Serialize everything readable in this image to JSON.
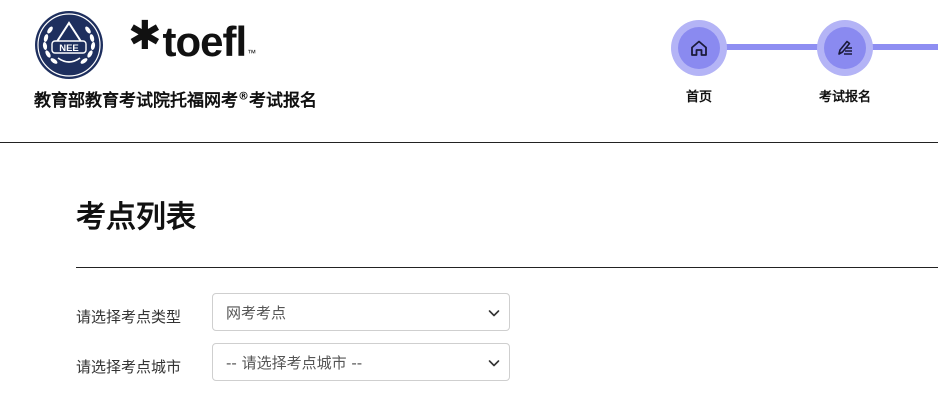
{
  "header": {
    "org_title": "教育部教育考试院托福网考",
    "org_title_mark": "®",
    "org_title_suffix": "考试报名",
    "nee_logo_text": "NEE",
    "toefl_logo_text": "toefl",
    "toefl_logo_mark": "™"
  },
  "steps": [
    {
      "label": "首页",
      "icon": "home-icon"
    },
    {
      "label": "考试报名",
      "icon": "edit-list-icon"
    }
  ],
  "main": {
    "title": "考点列表",
    "fields": [
      {
        "label": "请选择考点类型",
        "selected": "网考考点"
      },
      {
        "label": "请选择考点城市",
        "selected": "-- 请选择考点城市 --"
      }
    ]
  },
  "colors": {
    "step_outer": "#b4b4f6",
    "step_inner": "#8a8af0",
    "step_line": "#8e8ef2",
    "logo_navy": "#1e2f5e"
  }
}
